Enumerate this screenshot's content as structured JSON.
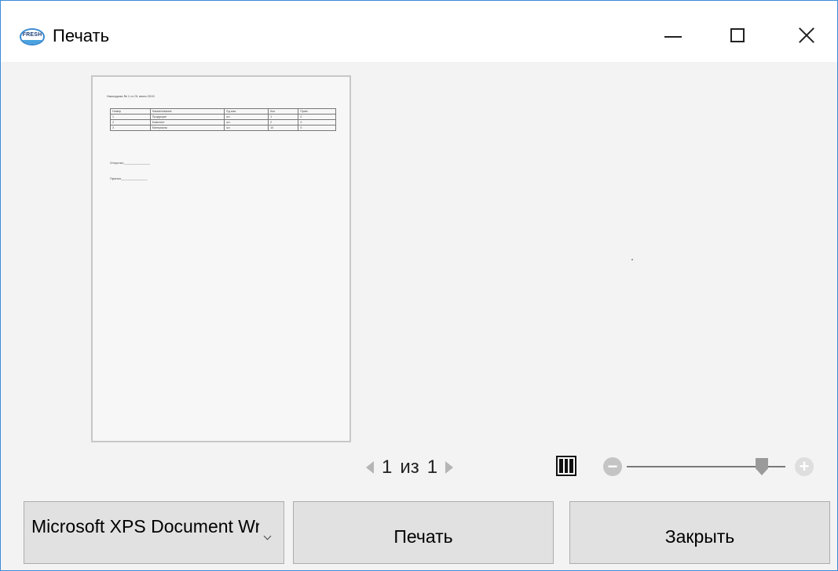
{
  "window": {
    "title": "Печать",
    "icon": "fresh-logo-icon",
    "icon_text": "FRESH",
    "controls": [
      "minimize-icon",
      "maximize-icon",
      "close-icon"
    ]
  },
  "preview": {
    "doc_heading": "Накладная № 1 от 01 июля 2019",
    "table": {
      "headers": [
        "Номер",
        "Наименование",
        "Ед.изм.",
        "Кол.",
        "Прим."
      ],
      "rows": [
        [
          "1",
          "Продукция",
          "шт.",
          "1",
          "0"
        ],
        [
          "2",
          "Комплект",
          "шт.",
          "2",
          "0"
        ],
        [
          "3",
          "Материалы",
          "шт.",
          "10",
          "0"
        ]
      ]
    },
    "signatures": [
      "Отпустил_______________",
      "Принял_______________"
    ]
  },
  "pager": {
    "current": "1",
    "separator": "из",
    "total": "1"
  },
  "zoom": {
    "level": 0.85,
    "minus_icon": "zoom-out-icon",
    "plus_icon": "zoom-in-icon",
    "layout_icon": "two-page-view-icon"
  },
  "printer": {
    "selected": "Microsoft XPS Document Writer"
  },
  "buttons": {
    "print": "Печать",
    "close": "Закрыть"
  }
}
